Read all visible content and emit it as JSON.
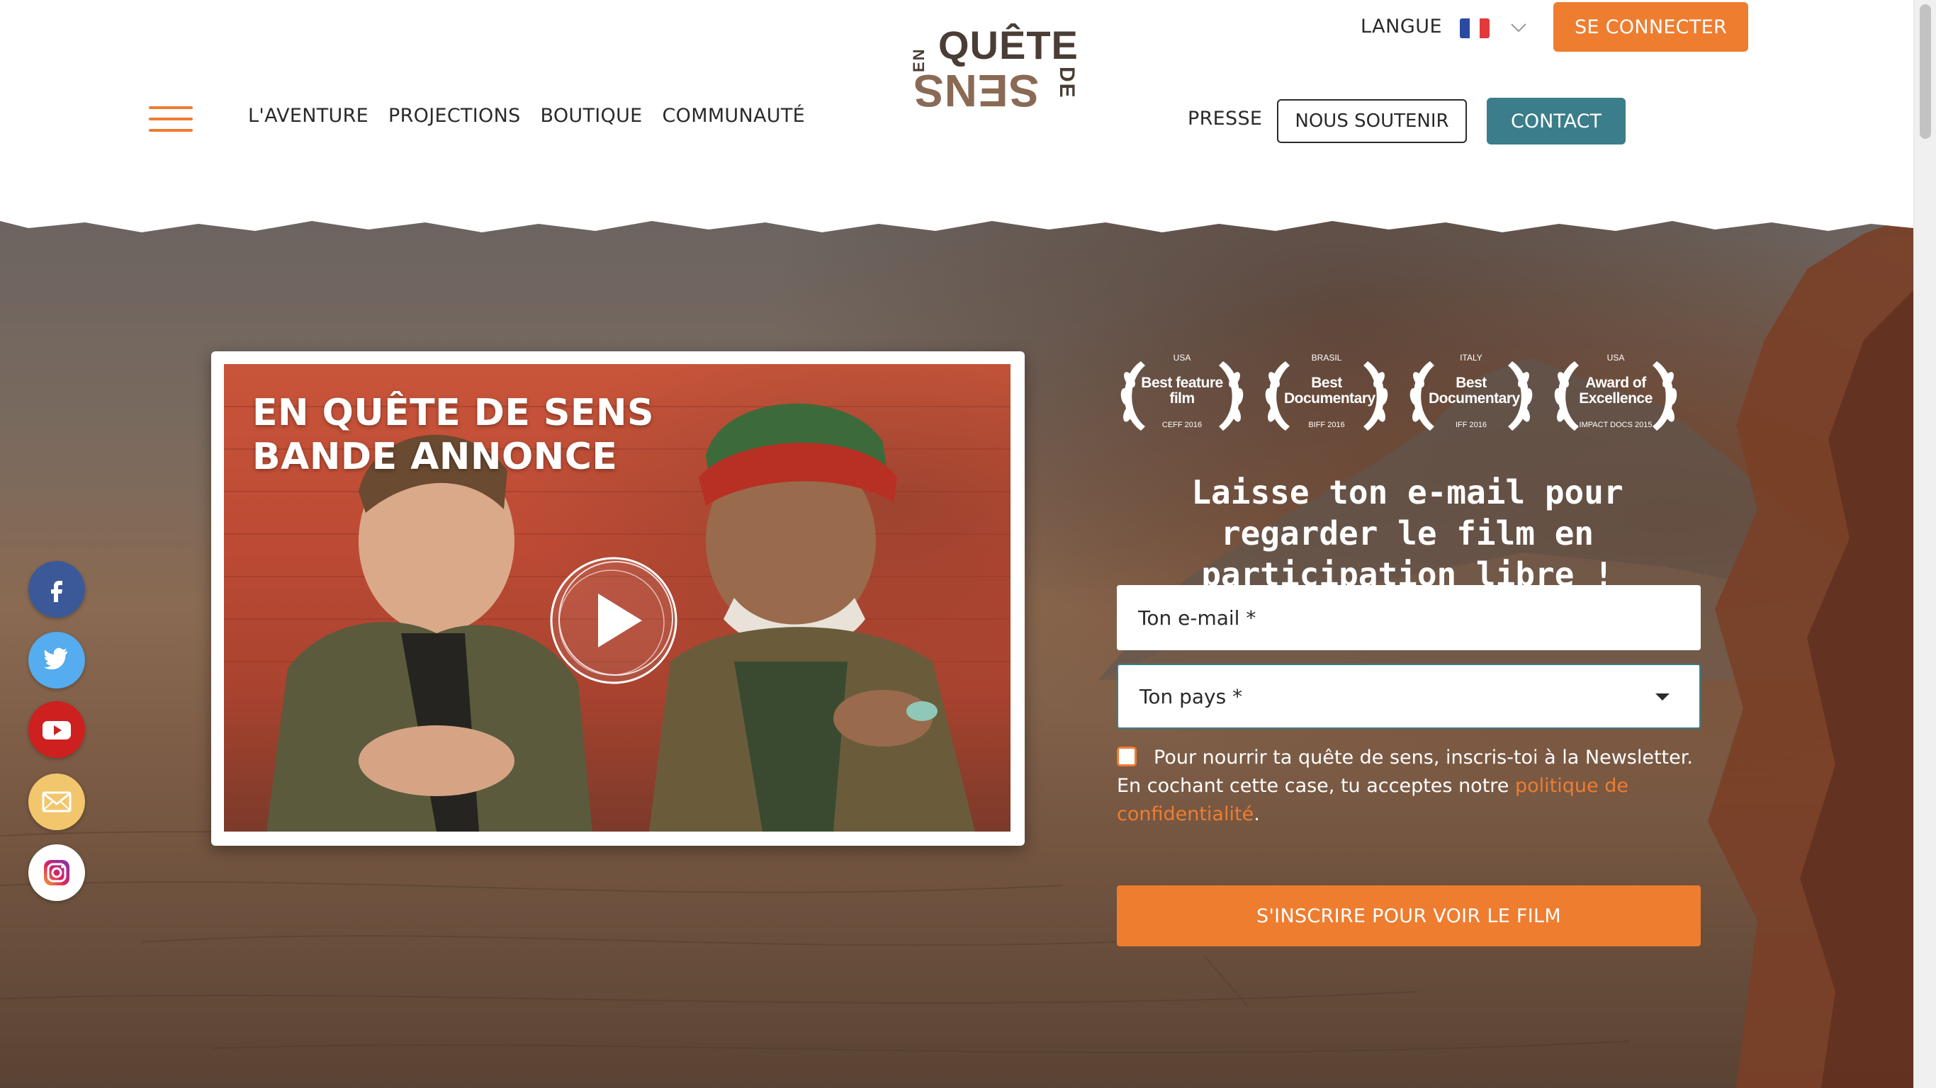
{
  "header": {
    "logo": {
      "line1": "QUÊTE",
      "prefix": "EN",
      "line2": "SENS",
      "suffix": "DE"
    },
    "nav_left": [
      "L'AVENTURE",
      "PROJECTIONS",
      "BOUTIQUE",
      "COMMUNAUTÉ"
    ],
    "language_label": "LANGUE",
    "language_flag": "france-flag",
    "login_label": "SE CONNECTER",
    "press_label": "PRESSE",
    "support_label": "NOUS SOUTENIR",
    "contact_label": "CONTACT"
  },
  "video": {
    "title_line1": "EN QUÊTE DE SENS",
    "title_line2": "BANDE ANNONCE",
    "play_icon": "play-icon"
  },
  "awards": [
    {
      "country": "USA",
      "award": "Best feature film",
      "festival": "CEFF 2016"
    },
    {
      "country": "BRASIL",
      "award": "Best Documentary",
      "festival": "BIFF 2016"
    },
    {
      "country": "ITALY",
      "award": "Best Documentary",
      "festival": "IFF 2016"
    },
    {
      "country": "USA",
      "award": "Award of Excellence",
      "festival": "IMPACT DOCS 2015"
    }
  ],
  "signup": {
    "title": "Laisse ton e-mail pour regarder le film en participation libre !",
    "email_placeholder": "Ton e-mail *",
    "country_placeholder": "Ton pays *",
    "consent_text": "Pour nourrir ta quête de sens, inscris-toi à la Newsletter. En cochant cette case, tu acceptes notre ",
    "consent_link": "politique de confidentialité",
    "consent_end": ".",
    "submit_label": "S'INSCRIRE POUR VOIR LE FILM"
  },
  "social": [
    "facebook-icon",
    "twitter-icon",
    "youtube-icon",
    "mail-icon",
    "instagram-icon"
  ],
  "colors": {
    "accent": "#ee7d30",
    "contact": "#3b7d8a",
    "logo": "#4a3d35"
  }
}
